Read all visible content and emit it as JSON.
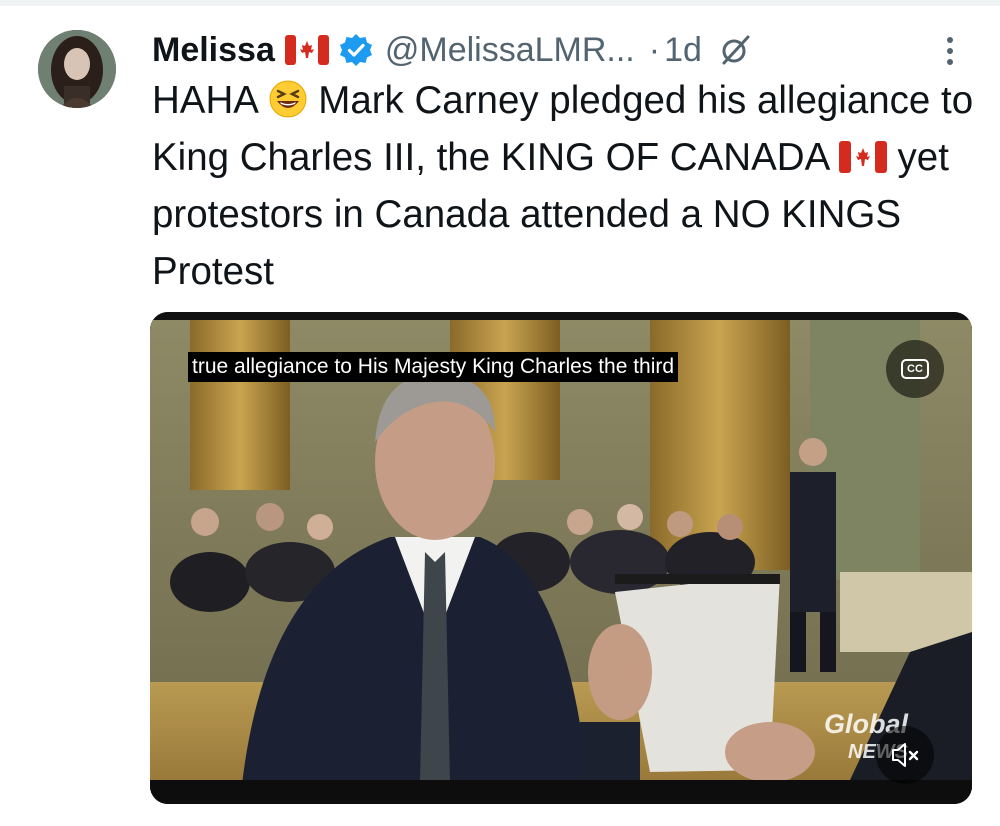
{
  "tweet": {
    "author": {
      "display_name": "Melissa",
      "name_emoji": "canada-flag",
      "verified": true,
      "handle": "@MelissaLMR...",
      "separator": "·",
      "time": "1d"
    },
    "text_parts": [
      "HAHA",
      "Mark Carney pledged his allegiance to King Charles III, the KING OF CANADA",
      "yet protestors in Canada attended a NO KINGS Protest"
    ],
    "inline_emojis": [
      "grinning-squinting-face",
      "canada-flag"
    ],
    "media": {
      "type": "video",
      "caption": "true allegiance to His Majesty King Charles the third",
      "cc_label": "CC",
      "watermark_line1": "Global",
      "watermark_line2": "NEWS",
      "muted": true
    }
  },
  "icons": {
    "verified": "verified-badge-icon",
    "grok": "grok-icon",
    "more": "more-options-icon",
    "mute": "volume-muted-icon"
  },
  "colors": {
    "text_primary": "#0f1419",
    "text_secondary": "#536471",
    "verified_blue": "#1d9bf0",
    "flag_red": "#d52b1e"
  }
}
